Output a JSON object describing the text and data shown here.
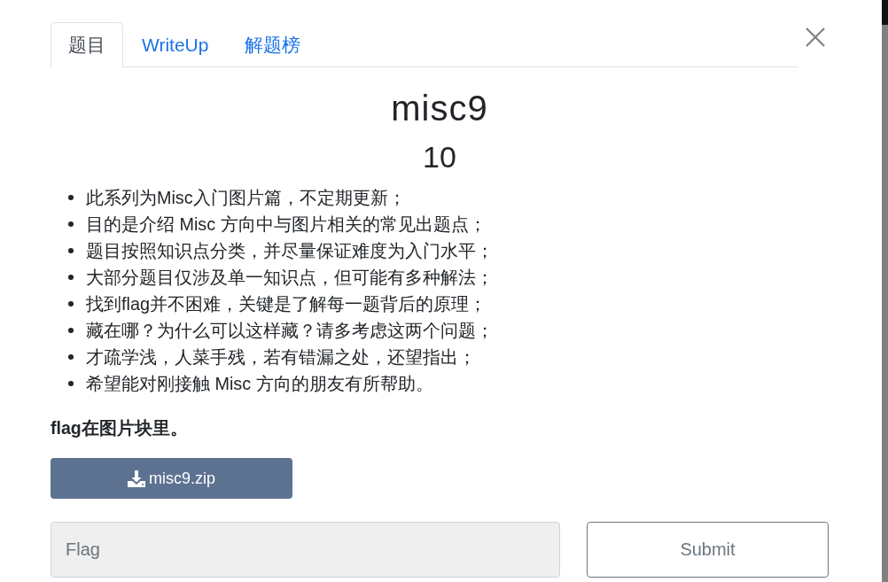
{
  "tabs": [
    {
      "label": "题目",
      "selected": true
    },
    {
      "label": "WriteUp",
      "selected": false
    },
    {
      "label": "解题榜",
      "selected": false
    }
  ],
  "challenge": {
    "name": "misc9",
    "points": "10",
    "description": [
      "此系列为Misc入门图片篇，不定期更新；",
      "目的是介绍 Misc 方向中与图片相关的常见出题点；",
      "题目按照知识点分类，并尽量保证难度为入门水平；",
      "大部分题目仅涉及单一知识点，但可能有多种解法；",
      "找到flag并不困难，关键是了解每一题背后的原理；",
      "藏在哪？为什么可以这样藏？请多考虑这两个问题；",
      "才疏学浅，人菜手残，若有错漏之处，还望指出；",
      "希望能对刚接触 Misc 方向的朋友有所帮助。"
    ],
    "hint": "flag在图片块里。"
  },
  "download": {
    "label": "misc9.zip"
  },
  "flag_field": {
    "placeholder": "Flag"
  },
  "submit": {
    "label": "Submit"
  }
}
